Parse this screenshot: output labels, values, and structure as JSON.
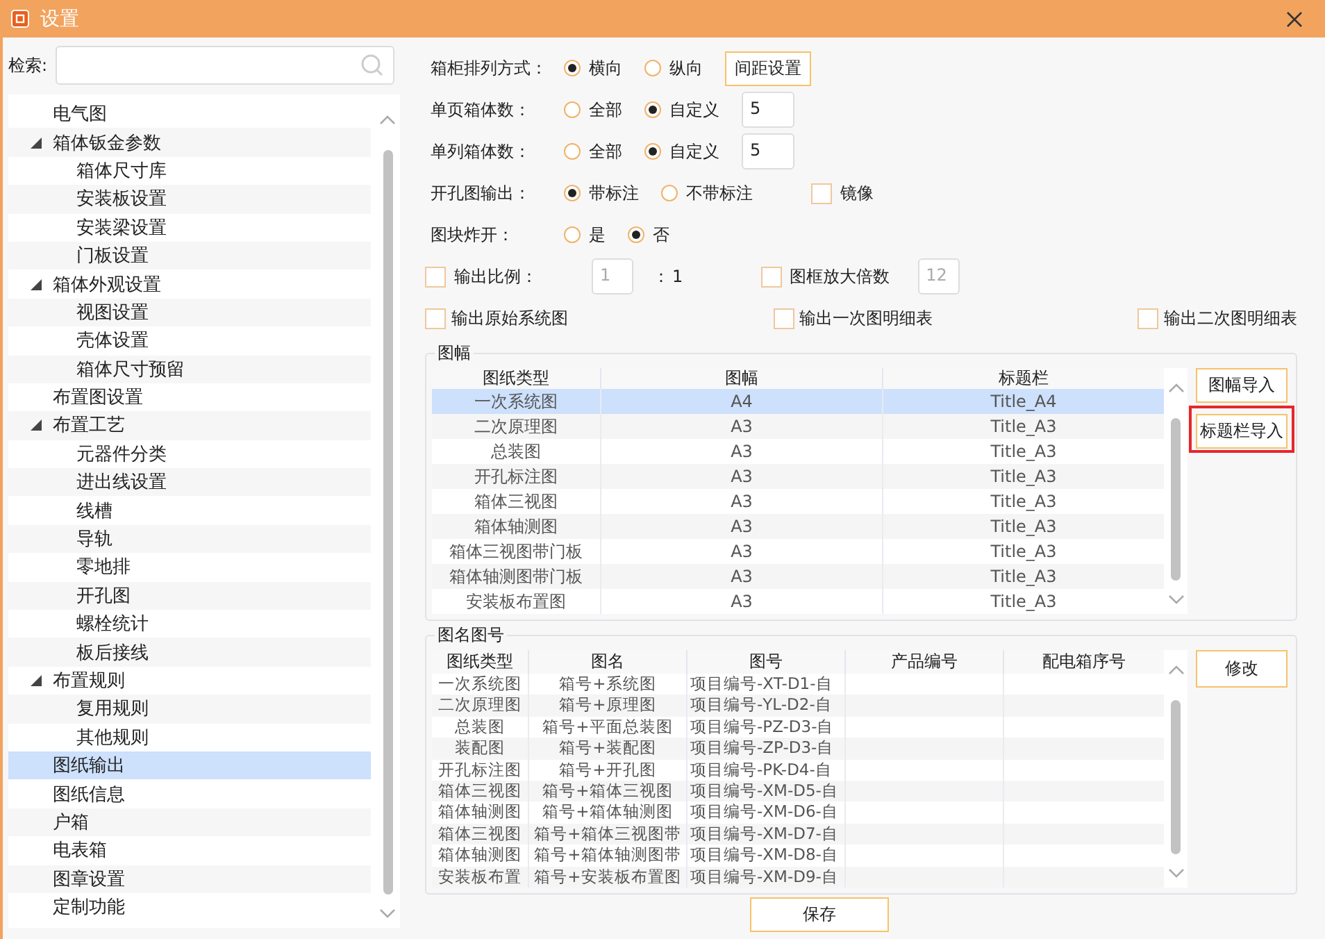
{
  "window": {
    "title": "设置"
  },
  "search": {
    "label": "检索:"
  },
  "sidebar": {
    "items": [
      {
        "label": "电气图",
        "selected": false
      },
      {
        "label": "箱体钣金参数",
        "expanded": true,
        "selected": false,
        "children": [
          {
            "label": "箱体尺寸库",
            "selected": false
          },
          {
            "label": "安装板设置",
            "selected": false
          },
          {
            "label": "安装梁设置",
            "selected": false
          },
          {
            "label": "门板设置",
            "selected": false
          }
        ]
      },
      {
        "label": "箱体外观设置",
        "expanded": true,
        "selected": false,
        "children": [
          {
            "label": "视图设置",
            "selected": false
          },
          {
            "label": "壳体设置",
            "selected": false
          },
          {
            "label": "箱体尺寸预留",
            "selected": false
          }
        ]
      },
      {
        "label": "布置图设置",
        "selected": false
      },
      {
        "label": "布置工艺",
        "expanded": true,
        "selected": false,
        "children": [
          {
            "label": "元器件分类",
            "selected": false
          },
          {
            "label": "进出线设置",
            "selected": false
          },
          {
            "label": "线槽",
            "selected": false
          },
          {
            "label": "导轨",
            "selected": false
          },
          {
            "label": "零地排",
            "selected": false
          },
          {
            "label": "开孔图",
            "selected": false
          },
          {
            "label": "螺栓统计",
            "selected": false
          },
          {
            "label": "板后接线",
            "selected": false
          }
        ]
      },
      {
        "label": "布置规则",
        "expanded": true,
        "selected": false,
        "children": [
          {
            "label": "复用规则",
            "selected": false
          },
          {
            "label": "其他规则",
            "selected": false
          }
        ]
      },
      {
        "label": "图纸输出",
        "selected": true
      },
      {
        "label": "图纸信息",
        "selected": false
      },
      {
        "label": "户箱",
        "selected": false
      },
      {
        "label": "电表箱",
        "selected": false
      },
      {
        "label": "图章设置",
        "selected": false
      },
      {
        "label": "定制功能",
        "selected": false
      }
    ]
  },
  "form": {
    "rows": [
      {
        "kind": "choice",
        "label": "箱柜排列方式：",
        "items": [
          {
            "kind": "radio",
            "label": "横向",
            "selected": true
          },
          {
            "kind": "radio",
            "label": "纵向",
            "selected": false
          },
          {
            "kind": "button",
            "label": "间距设置"
          }
        ]
      },
      {
        "kind": "choice",
        "label": "单页箱体数：",
        "items": [
          {
            "kind": "radio",
            "label": "全部",
            "selected": false
          },
          {
            "kind": "radio",
            "label": "自定义",
            "selected": true
          },
          {
            "kind": "input",
            "value": "5",
            "disabled": false
          }
        ]
      },
      {
        "kind": "choice",
        "label": "单列箱体数：",
        "items": [
          {
            "kind": "radio",
            "label": "全部",
            "selected": false
          },
          {
            "kind": "radio",
            "label": "自定义",
            "selected": true
          },
          {
            "kind": "input",
            "value": "5",
            "disabled": false
          }
        ]
      },
      {
        "kind": "choice",
        "label": "开孔图输出：",
        "items": [
          {
            "kind": "radio",
            "label": "带标注",
            "selected": true
          },
          {
            "kind": "radio",
            "label": "不带标注",
            "selected": false
          },
          {
            "kind": "checkbox",
            "label": "镜像",
            "checked": false
          }
        ]
      },
      {
        "kind": "choice",
        "label": "图块炸开：",
        "items": [
          {
            "kind": "radio",
            "label": "是",
            "selected": false
          },
          {
            "kind": "radio",
            "label": "否",
            "selected": true
          }
        ]
      },
      {
        "kind": "scale",
        "items": [
          {
            "kind": "checkbox",
            "label": "输出比例：",
            "checked": false
          },
          {
            "kind": "input",
            "value": "1",
            "disabled": true
          },
          {
            "kind": "text",
            "label": "："
          },
          {
            "kind": "text",
            "label": "1"
          },
          {
            "kind": "checkbox",
            "label": "图框放大倍数",
            "checked": false
          },
          {
            "kind": "input",
            "value": "12",
            "disabled": true
          }
        ]
      },
      {
        "kind": "spread",
        "items": [
          {
            "kind": "checkbox",
            "label": "输出原始系统图",
            "checked": false
          },
          {
            "kind": "checkbox",
            "label": "输出一次图明细表",
            "checked": false
          },
          {
            "kind": "checkbox",
            "label": "输出二次图明细表",
            "checked": false
          }
        ]
      }
    ]
  },
  "sheet_group": {
    "title": "图幅",
    "columns": [
      "图纸类型",
      "图幅",
      "标题栏"
    ],
    "rows": [
      {
        "cells": [
          "一次系统图",
          "A4",
          "Title_A4"
        ],
        "selected": true
      },
      {
        "cells": [
          "二次原理图",
          "A3",
          "Title_A3"
        ],
        "selected": false
      },
      {
        "cells": [
          "总装图",
          "A3",
          "Title_A3"
        ],
        "selected": false
      },
      {
        "cells": [
          "开孔标注图",
          "A3",
          "Title_A3"
        ],
        "selected": false
      },
      {
        "cells": [
          "箱体三视图",
          "A3",
          "Title_A3"
        ],
        "selected": false
      },
      {
        "cells": [
          "箱体轴测图",
          "A3",
          "Title_A3"
        ],
        "selected": false
      },
      {
        "cells": [
          "箱体三视图带门板",
          "A3",
          "Title_A3"
        ],
        "selected": false
      },
      {
        "cells": [
          "箱体轴测图带门板",
          "A3",
          "Title_A3"
        ],
        "selected": false
      },
      {
        "cells": [
          "安装板布置图",
          "A3",
          "Title_A3"
        ],
        "selected": false
      }
    ],
    "buttons": [
      {
        "label": "图幅导入"
      },
      {
        "label": "标题栏导入",
        "highlighted": true
      }
    ]
  },
  "name_group": {
    "title": "图名图号",
    "columns": [
      "图纸类型",
      "图名",
      "图号",
      "产品编号",
      "配电箱序号"
    ],
    "rows": [
      [
        "一次系统图",
        "箱号+系统图",
        "项目编号-XT-D1-自",
        "",
        ""
      ],
      [
        "二次原理图",
        "箱号+原理图",
        "项目编号-YL-D2-自",
        "",
        ""
      ],
      [
        "总装图",
        "箱号+平面总装图",
        "项目编号-PZ-D3-自",
        "",
        ""
      ],
      [
        "装配图",
        "箱号+装配图",
        "项目编号-ZP-D3-自",
        "",
        ""
      ],
      [
        "开孔标注图",
        "箱号+开孔图",
        "项目编号-PK-D4-自",
        "",
        ""
      ],
      [
        "箱体三视图",
        "箱号+箱体三视图",
        "项目编号-XM-D5-自",
        "",
        ""
      ],
      [
        "箱体轴测图",
        "箱号+箱体轴测图",
        "项目编号-XM-D6-自",
        "",
        ""
      ],
      [
        "箱体三视图",
        "箱号+箱体三视图带",
        "项目编号-XM-D7-自",
        "",
        ""
      ],
      [
        "箱体轴测图",
        "箱号+箱体轴测图带",
        "项目编号-XM-D8-自",
        "",
        ""
      ],
      [
        "安装板布置",
        "箱号+安装板布置图",
        "项目编号-XM-D9-自",
        "",
        ""
      ]
    ],
    "buttons": [
      {
        "label": "修改"
      }
    ]
  },
  "footer": {
    "buttons": [
      {
        "label": "保存"
      }
    ]
  }
}
